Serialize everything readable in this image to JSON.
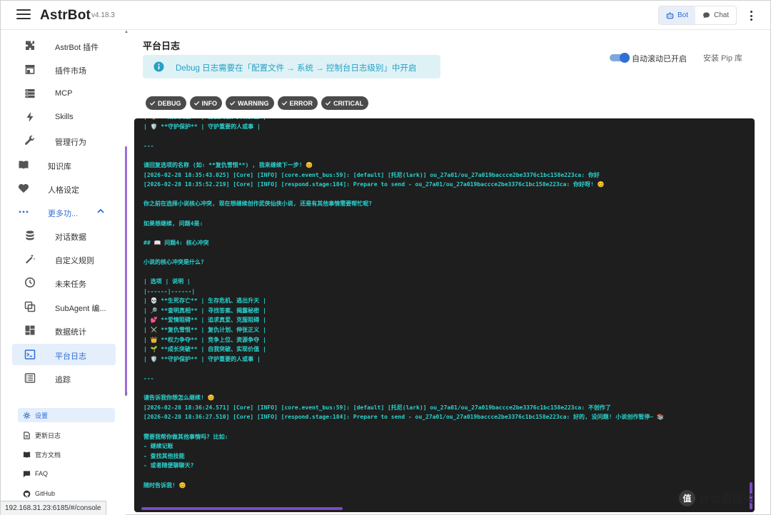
{
  "header": {
    "logo": "AstrBot",
    "version": "v4.18.3",
    "mode_bot": "Bot",
    "mode_chat": "Chat"
  },
  "sidebar": {
    "items": [
      {
        "label": "AstrBot 插件",
        "icon": "puzzle-icon"
      },
      {
        "label": "插件市场",
        "icon": "store-icon"
      },
      {
        "label": "MCP",
        "icon": "server-icon"
      },
      {
        "label": "Skills",
        "icon": "lightning-icon"
      },
      {
        "label": "管理行为",
        "icon": "wrench-icon"
      },
      {
        "label": "知识库",
        "icon": "book-icon"
      },
      {
        "label": "人格设定",
        "icon": "heart-icon"
      },
      {
        "label": "更多功...",
        "icon": "dots-icon"
      },
      {
        "label": "对话数据",
        "icon": "database-icon"
      },
      {
        "label": "自定义规则",
        "icon": "magic-wand-icon"
      },
      {
        "label": "未来任务",
        "icon": "clock-icon"
      },
      {
        "label": "SubAgent 编...",
        "icon": "subagent-icon"
      },
      {
        "label": "数据统计",
        "icon": "dashboard-icon"
      },
      {
        "label": "平台日志",
        "icon": "console-icon"
      },
      {
        "label": "追踪",
        "icon": "list-icon"
      }
    ],
    "footer": [
      {
        "label": "设置",
        "icon": "gear-icon"
      },
      {
        "label": "更新日志",
        "icon": "document-icon"
      },
      {
        "label": "官方文档",
        "icon": "book-icon"
      },
      {
        "label": "FAQ",
        "icon": "chat-icon"
      },
      {
        "label": "GitHub",
        "icon": "github-icon"
      }
    ]
  },
  "status_url": "192.168.31.23:6185/#/console",
  "main": {
    "title": "平台日志",
    "alert": "Debug 日志需要在「配置文件 → 系统 → 控制台日志级别」中开启",
    "autoscroll_label": "自动滚动已开启",
    "pip_label": "安装 Pip 库",
    "filters": [
      "DEBUG",
      "INFO",
      "WARNING",
      "ERROR",
      "CRITICAL"
    ]
  },
  "console_lines": [
    "| 🏆 **成长突破** | 自我突破、实现价值 |",
    "| 🛡️ **守护保护** | 守护重要的人或事 |",
    "",
    "---",
    "",
    "请回复选项的名称 (如: **复仇雪恨**) , 我来继续下一步! 😊",
    "[2026-02-28 18:35:43.025] [Core] [INFO] [core.event_bus:59]: [default] [托尼(lark)] ou_27a01/ou_27a019baccce2be3376c1bc158e223ca: 你好",
    "[2026-02-28 18:35:52.219] [Core] [INFO] [respond.stage:184]: Prepare to send - ou_27a01/ou_27a019baccce2be3376c1bc158e223ca: 你好呀! 😊",
    "",
    "你之前在选择小说核心冲突, 现在想继续创作武侠仙侠小说, 还是有其他事情需要帮忙呢?",
    "",
    "如果想继续, 问题4是:",
    "",
    "## 📖 问题4: 核心冲突",
    "",
    "小说的核心冲突是什么?",
    "",
    "| 选项 | 说明 |",
    "|------|------|",
    "| 💀 **生死存亡** | 生存危机、逃出升天 |",
    "| 🔎 **查明真相** | 寻找答案、揭露秘密 |",
    "| 💕 **爱情阻碍** | 追求真爱、克服阻碍 |",
    "| ⚔️ **复仇雪恨** | 复仇计划、伸张正义 |",
    "| 👑 **权力争夺** | 竞争上位、资源争夺 |",
    "| 🌱 **成长突破** | 自我突破、实现价值 |",
    "| 🛡️ **守护保护** | 守护重要的人或事 |",
    "",
    "---",
    "",
    "请告诉我你想怎么继续! 😊",
    "[2026-02-28 18:36:24.571] [Core] [INFO] [core.event_bus:59]: [default] [托尼(lark)] ou_27a01/ou_27a019baccce2be3376c1bc158e223ca: 不创作了",
    "[2026-02-28 18:36:27.510] [Core] [INFO] [respond.stage:184]: Prepare to send - ou_27a01/ou_27a019baccce2be3376c1bc158e223ca: 好的, 没问题! 小说创作暂停~ 📚",
    "",
    "需要我帮你做其他事情吗? 比如:",
    "- 继续记账",
    "- 查找其他技能",
    "- 或者随便聊聊天?",
    "",
    "随时告诉我! 😊"
  ],
  "watermark": "什么值得买",
  "colors": {
    "accent": "#2f6fd6",
    "console_bg": "#1e1e1e",
    "console_text": "#29d3cf",
    "alert_bg": "#def2f6",
    "alert_text": "#27a0c4",
    "scrollbar": "#7b4ac4"
  }
}
